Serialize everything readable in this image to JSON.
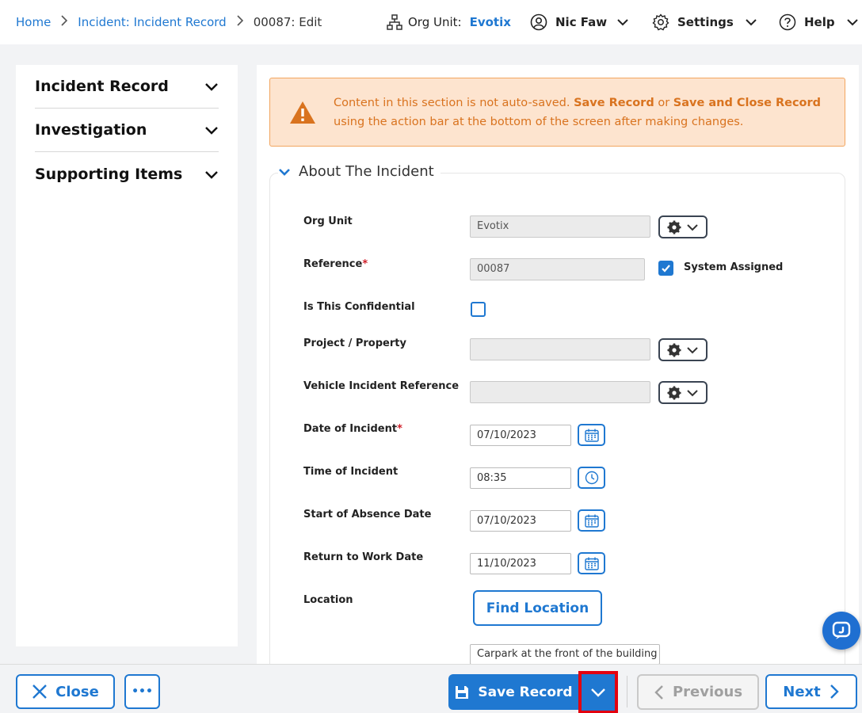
{
  "breadcrumb": {
    "home": "Home",
    "module": "Incident: Incident Record",
    "current": "00087: Edit"
  },
  "topbar": {
    "org_unit_label": "Org Unit:",
    "org_unit_value": "Evotix",
    "user": "Nic Faw",
    "settings": "Settings",
    "help": "Help"
  },
  "sidebar": {
    "items": [
      {
        "label": "Incident Record"
      },
      {
        "label": "Investigation"
      },
      {
        "label": "Supporting Items"
      }
    ]
  },
  "alert": {
    "text_1": "Content in this section is not auto-saved.",
    "bold_1": "Save Record",
    "text_2": "or",
    "bold_2": "Save and Close Record",
    "text_3": "using the action bar at the bottom of the screen after making changes."
  },
  "section": {
    "title": "About The Incident"
  },
  "form": {
    "org_unit": {
      "label": "Org Unit",
      "value": "Evotix"
    },
    "reference": {
      "label": "Reference",
      "required": "*",
      "value": "00087",
      "system_assigned_label": "System Assigned",
      "system_assigned": true
    },
    "confidential": {
      "label": "Is This Confidential",
      "checked": false
    },
    "project": {
      "label": "Project / Property",
      "value": ""
    },
    "vehicle": {
      "label": "Vehicle Incident Reference",
      "value": ""
    },
    "date_incident": {
      "label": "Date of Incident",
      "required": "*",
      "value": "07/10/2023"
    },
    "time_incident": {
      "label": "Time of Incident",
      "value": "08:35"
    },
    "absence_start": {
      "label": "Start of Absence Date",
      "value": "07/10/2023"
    },
    "return_work": {
      "label": "Return to Work Date",
      "value": "11/10/2023"
    },
    "location": {
      "label": "Location",
      "find_button": "Find Location",
      "value": "Carpark at the front of the building"
    }
  },
  "actions": {
    "close": "Close",
    "more": "•••",
    "save": "Save Record",
    "previous": "Previous",
    "next": "Next"
  },
  "colors": {
    "accent": "#1f78d1",
    "alert_bg": "#fde4cf",
    "alert_text": "#d9731f",
    "highlight": "#e3000f"
  }
}
